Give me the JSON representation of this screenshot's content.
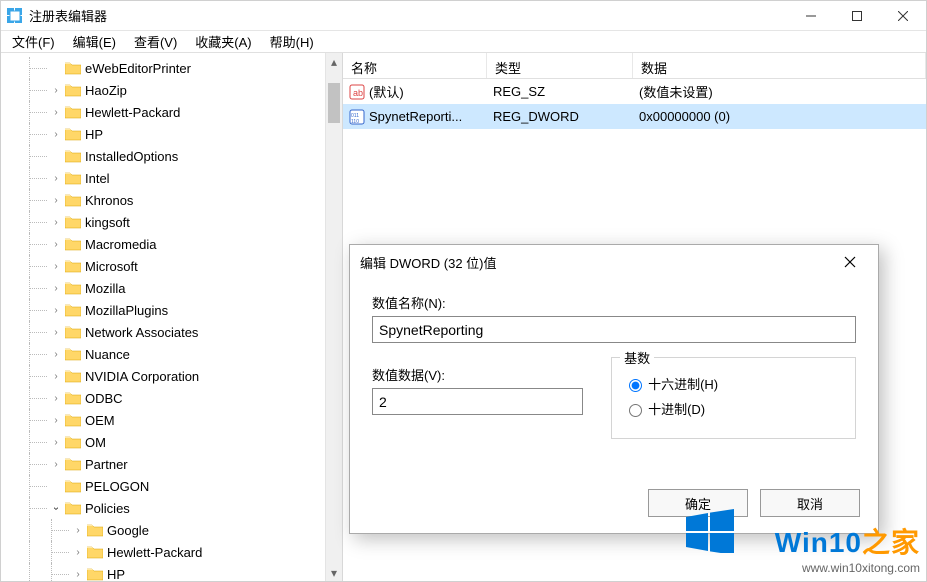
{
  "window": {
    "title": "注册表编辑器"
  },
  "menu": {
    "file": "文件(F)",
    "edit": "编辑(E)",
    "view": "查看(V)",
    "fav": "收藏夹(A)",
    "help": "帮助(H)"
  },
  "tree": {
    "items": [
      {
        "label": "eWebEditorPrinter",
        "expandable": false,
        "depth": 3
      },
      {
        "label": "HaoZip",
        "expandable": true,
        "depth": 3
      },
      {
        "label": "Hewlett-Packard",
        "expandable": true,
        "depth": 3
      },
      {
        "label": "HP",
        "expandable": true,
        "depth": 3
      },
      {
        "label": "InstalledOptions",
        "expandable": false,
        "depth": 3
      },
      {
        "label": "Intel",
        "expandable": true,
        "depth": 3
      },
      {
        "label": "Khronos",
        "expandable": true,
        "depth": 3
      },
      {
        "label": "kingsoft",
        "expandable": true,
        "depth": 3
      },
      {
        "label": "Macromedia",
        "expandable": true,
        "depth": 3
      },
      {
        "label": "Microsoft",
        "expandable": true,
        "depth": 3
      },
      {
        "label": "Mozilla",
        "expandable": true,
        "depth": 3
      },
      {
        "label": "MozillaPlugins",
        "expandable": true,
        "depth": 3
      },
      {
        "label": "Network Associates",
        "expandable": true,
        "depth": 3
      },
      {
        "label": "Nuance",
        "expandable": true,
        "depth": 3
      },
      {
        "label": "NVIDIA Corporation",
        "expandable": true,
        "depth": 3
      },
      {
        "label": "ODBC",
        "expandable": true,
        "depth": 3
      },
      {
        "label": "OEM",
        "expandable": true,
        "depth": 3
      },
      {
        "label": "OM",
        "expandable": true,
        "depth": 3
      },
      {
        "label": "Partner",
        "expandable": true,
        "depth": 3
      },
      {
        "label": "PELOGON",
        "expandable": false,
        "depth": 3
      },
      {
        "label": "Policies",
        "expandable": true,
        "depth": 3,
        "expanded": true
      },
      {
        "label": "Google",
        "expandable": true,
        "depth": 4
      },
      {
        "label": "Hewlett-Packard",
        "expandable": true,
        "depth": 4
      },
      {
        "label": "HP",
        "expandable": true,
        "depth": 4
      }
    ]
  },
  "list": {
    "headers": {
      "name": "名称",
      "type": "类型",
      "data": "数据"
    },
    "rows": [
      {
        "name": "(默认)",
        "type": "REG_SZ",
        "data": "(数值未设置)",
        "icon": "string"
      },
      {
        "name": "SpynetReporti...",
        "type": "REG_DWORD",
        "data": "0x00000000 (0)",
        "icon": "dword",
        "selected": true
      }
    ],
    "col_widths": {
      "name": 144,
      "type": 146,
      "data": 280
    }
  },
  "dialog": {
    "title": "编辑 DWORD (32 位)值",
    "name_label": "数值名称(N):",
    "name_value": "SpynetReporting",
    "data_label": "数值数据(V):",
    "data_value": "2",
    "base_label": "基数",
    "hex_label": "十六进制(H)",
    "dec_label": "十进制(D)",
    "ok": "确定",
    "cancel": "取消"
  },
  "watermark": {
    "brand_en": "Win10",
    "brand_zh": "之家",
    "url": "www.win10xitong.com"
  }
}
